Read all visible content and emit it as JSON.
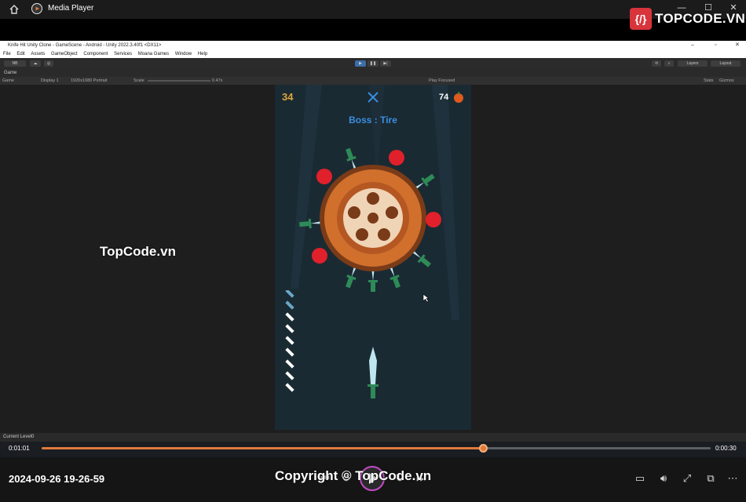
{
  "player": {
    "title": "Media Player",
    "logo_text": "TOPCODE.VN",
    "logo_glyph": "{/}",
    "window_controls": [
      "—",
      "☐",
      "✕"
    ]
  },
  "unity": {
    "window_title": "Knife Hit Unity Clone - GameScene - Android - Unity 2022.3.40f1 <DX11>",
    "menu": [
      "File",
      "Edit",
      "Assets",
      "GameObject",
      "Component",
      "Services",
      "Moana Games",
      "Window",
      "Help"
    ],
    "toolbar": {
      "account": "NB",
      "layers": "Layers",
      "layout": "Layout"
    },
    "game_tab": "Game",
    "gamebar": {
      "view": "Game",
      "display": "Display 1",
      "resolution": "1920x1080 Portrait",
      "scale_label": "Scale",
      "scale_value": "0.47x",
      "play_focused": "Play Focused",
      "stats": "Stats",
      "gizmos": "Gizmos"
    },
    "status": "Current Level0"
  },
  "game": {
    "score": "34",
    "apples": "74",
    "boss": "Boss : Tire",
    "knives_remaining": 9
  },
  "watermark": "TopCode.vn",
  "copyright": "Copyright © TopCode.vn",
  "playback": {
    "current": "0:01:01",
    "duration": "0:00:30",
    "progress": 0.66,
    "date": "2024-09-26 19-26-59"
  },
  "colors": {
    "accent": "#e07a3a",
    "boss": "#3a8ee0",
    "score": "#e1a43a",
    "background": "#1a2a33"
  },
  "icons": [
    "home-icon",
    "media-player-icon",
    "play-icon",
    "previous-icon",
    "next-icon",
    "subtitles-icon",
    "volume-icon",
    "fullscreen-icon",
    "mini-player-icon",
    "more-icon"
  ]
}
